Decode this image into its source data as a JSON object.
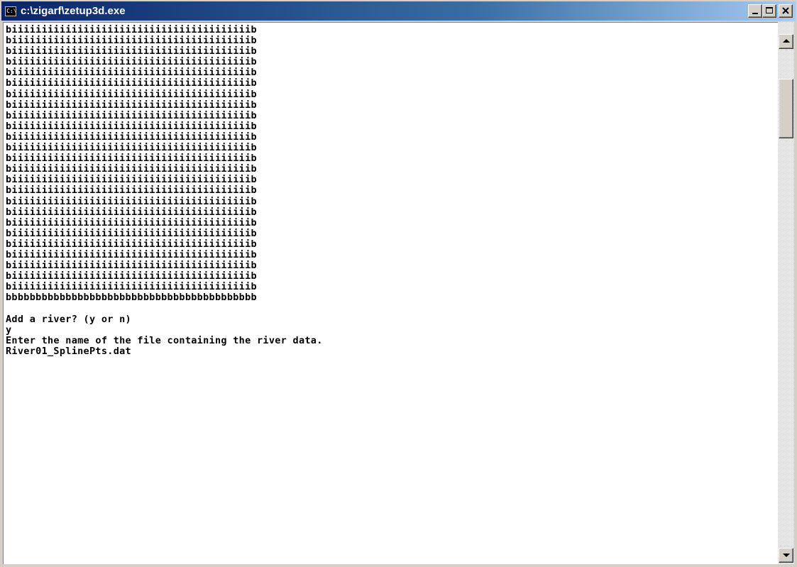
{
  "window": {
    "title": "c:\\zigarf\\zetup3d.exe",
    "icon_label": "C:\\"
  },
  "console": {
    "lines": [
      "biiiiiiiiiiiiiiiiiiiiiiiiiiiiiiiiiiiiiiiib",
      "biiiiiiiiiiiiiiiiiiiiiiiiiiiiiiiiiiiiiiiib",
      "biiiiiiiiiiiiiiiiiiiiiiiiiiiiiiiiiiiiiiiib",
      "biiiiiiiiiiiiiiiiiiiiiiiiiiiiiiiiiiiiiiiib",
      "biiiiiiiiiiiiiiiiiiiiiiiiiiiiiiiiiiiiiiiib",
      "biiiiiiiiiiiiiiiiiiiiiiiiiiiiiiiiiiiiiiiib",
      "biiiiiiiiiiiiiiiiiiiiiiiiiiiiiiiiiiiiiiiib",
      "biiiiiiiiiiiiiiiiiiiiiiiiiiiiiiiiiiiiiiiib",
      "biiiiiiiiiiiiiiiiiiiiiiiiiiiiiiiiiiiiiiiib",
      "biiiiiiiiiiiiiiiiiiiiiiiiiiiiiiiiiiiiiiiib",
      "biiiiiiiiiiiiiiiiiiiiiiiiiiiiiiiiiiiiiiiib",
      "biiiiiiiiiiiiiiiiiiiiiiiiiiiiiiiiiiiiiiiib",
      "biiiiiiiiiiiiiiiiiiiiiiiiiiiiiiiiiiiiiiiib",
      "biiiiiiiiiiiiiiiiiiiiiiiiiiiiiiiiiiiiiiiib",
      "biiiiiiiiiiiiiiiiiiiiiiiiiiiiiiiiiiiiiiiib",
      "biiiiiiiiiiiiiiiiiiiiiiiiiiiiiiiiiiiiiiiib",
      "biiiiiiiiiiiiiiiiiiiiiiiiiiiiiiiiiiiiiiiib",
      "biiiiiiiiiiiiiiiiiiiiiiiiiiiiiiiiiiiiiiiib",
      "biiiiiiiiiiiiiiiiiiiiiiiiiiiiiiiiiiiiiiiib",
      "biiiiiiiiiiiiiiiiiiiiiiiiiiiiiiiiiiiiiiiib",
      "biiiiiiiiiiiiiiiiiiiiiiiiiiiiiiiiiiiiiiiib",
      "biiiiiiiiiiiiiiiiiiiiiiiiiiiiiiiiiiiiiiiib",
      "biiiiiiiiiiiiiiiiiiiiiiiiiiiiiiiiiiiiiiiib",
      "biiiiiiiiiiiiiiiiiiiiiiiiiiiiiiiiiiiiiiiib",
      "biiiiiiiiiiiiiiiiiiiiiiiiiiiiiiiiiiiiiiiib",
      "bbbbbbbbbbbbbbbbbbbbbbbbbbbbbbbbbbbbbbbbbb",
      "",
      "Add a river? (y or n)",
      "y",
      "Enter the name of the file containing the river data.",
      "River01_SplinePts.dat"
    ]
  }
}
